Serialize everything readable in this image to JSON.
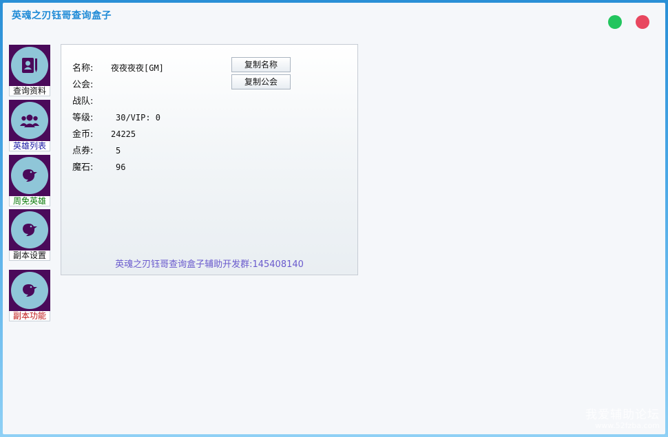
{
  "window": {
    "title": "英魂之刃钰哥查询盒子"
  },
  "sidebar": {
    "items": [
      {
        "label": "查询资料",
        "icon": "profile-card-icon",
        "color": "#111111"
      },
      {
        "label": "英雄列表",
        "icon": "group-users-icon",
        "color": "#1a1aa6"
      },
      {
        "label": "周免英雄",
        "icon": "bird-icon",
        "color": "#0a7a0a"
      },
      {
        "label": "副本设置",
        "icon": "bird-icon",
        "color": "#111111"
      },
      {
        "label": "副本功能",
        "icon": "bird-icon",
        "color": "#c01818"
      }
    ]
  },
  "info": {
    "name_label": "名称:",
    "name_value": "夜夜夜夜[GM]",
    "guild_label": "公会:",
    "guild_value": "",
    "team_label": "战队:",
    "team_value": "",
    "level_label": "等级:",
    "level_value": "30/VIP: 0",
    "gold_label": "金币:",
    "gold_value": "24225",
    "coupon_label": "点券:",
    "coupon_value": "5",
    "magic_label": "魔石:",
    "magic_value": "96"
  },
  "buttons": {
    "copy_name": "复制名称",
    "copy_guild": "复制公会"
  },
  "footer": "英魂之刃钰哥查询盒子辅助开发群:145408140",
  "watermark": {
    "line1": "我爱辅助论坛",
    "line2": "www.52fzba.com"
  },
  "colors": {
    "accent": "#1e8ad6",
    "minimize": "#22c55e",
    "close": "#e8475f",
    "icon_bg": "#4a0a5a",
    "icon_circle": "#8fc6d8"
  }
}
